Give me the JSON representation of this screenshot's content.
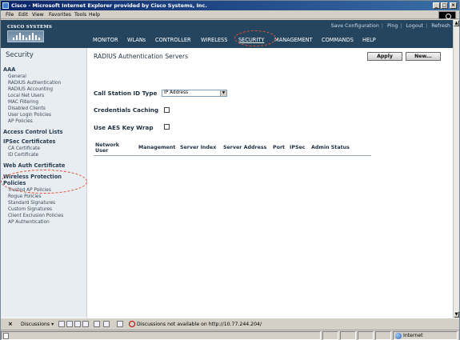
{
  "window": {
    "title": "Cisco - Microsoft Internet Explorer provided by Cisco Systems, Inc.",
    "controls": [
      "minimize-icon",
      "maximize-icon",
      "close-icon"
    ]
  },
  "menubar": {
    "items": [
      "File",
      "Edit",
      "View",
      "Favorites",
      "Tools",
      "Help"
    ]
  },
  "header": {
    "brand": "CISCO SYSTEMS",
    "utility_links": [
      "Save Configuration",
      "Ping",
      "Logout",
      "Refresh"
    ],
    "nav": [
      "MONITOR",
      "WLANs",
      "CONTROLLER",
      "WIRELESS",
      "SECURITY",
      "MANAGEMENT",
      "COMMANDS",
      "HELP"
    ],
    "active_nav": "SECURITY"
  },
  "sidebar": {
    "title": "Security",
    "aaa": {
      "heading": "AAA",
      "items": [
        "General",
        "RADIUS Authentication",
        "RADIUS Accounting",
        "Local Net Users",
        "MAC Filtering",
        "Disabled Clients",
        "User Login Policies",
        "AP Policies"
      ]
    },
    "access_control": "Access Control Lists",
    "ipsec": {
      "heading": "IPSec Certificates",
      "items": [
        "CA Certificate",
        "ID Certificate"
      ]
    },
    "web_auth": "Web Auth Certificate",
    "wireless_protection": {
      "heading_line1": "Wireless Protection",
      "heading_line2": "Policies",
      "items": [
        "Trusted AP Policies",
        "Rogue Policies",
        "Standard Signatures",
        "Custom Signatures",
        "Client Exclusion Policies",
        "AP Authentication"
      ]
    }
  },
  "main": {
    "page_title": "RADIUS Authentication Servers",
    "apply_label": "Apply",
    "new_label": "New...",
    "call_station_label": "Call Station ID Type",
    "call_station_value": "IP Address",
    "credentials_caching_label": "Credentials Caching",
    "aes_key_wrap_label": "Use AES Key Wrap",
    "table_headers": {
      "network_user_l1": "Network",
      "network_user_l2": "User",
      "management": "Management",
      "server_index": "Server Index",
      "server_address": "Server Address",
      "port": "Port",
      "ipsec": "IPSec",
      "admin_status": "Admin Status"
    }
  },
  "discussions": {
    "close": "×",
    "label": "Discussions ▾",
    "message": "Discussions not available on http://10.77.244.204/"
  },
  "status": {
    "zone": "Internet"
  },
  "colors": {
    "header_bg": "#25455e",
    "sidebar_bg": "#e8edf1",
    "annotation": "#e05030"
  }
}
